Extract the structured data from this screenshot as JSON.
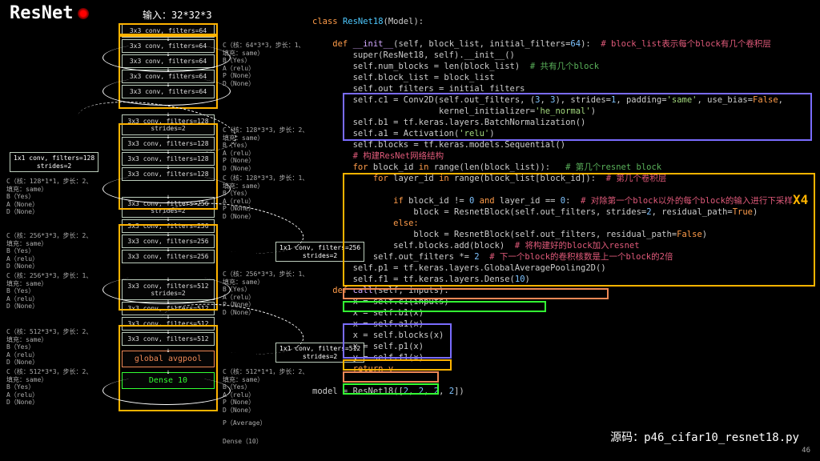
{
  "title": "ResNet",
  "input_label": "输入：32*32*3",
  "layers": [
    "3x3 conv, filters=64",
    "3x3 conv, filters=64",
    "3x3 conv, filters=64",
    "3x3 conv, filters=64",
    "3x3 conv, filters=64",
    "3x3 conv, filters=128\nstrides=2",
    "3x3 conv, filters=128",
    "3x3 conv, filters=128",
    "3x3 conv, filters=128",
    "3x3 conv, filters=256\nstrides=2",
    "3x3 conv, filters=256",
    "3x3 conv, filters=256",
    "3x3 conv, filters=256",
    "3x3 conv, filters=512\nstrides=2",
    "3x3 conv, filters=512",
    "3x3 conv, filters=512",
    "3x3 conv, filters=512"
  ],
  "final_pool": "global avgpool",
  "final_dense": "Dense 10",
  "side128": "1x1 conv, filters=128\nstrides=2",
  "side256": "1x1 conv, filters=256\nstrides=2",
  "side512": "1x1 conv, filters=512\nstrides=2",
  "ann": {
    "c64": "C（核：64*3*3，步长：1、\n填充：same）\nB（Yes）\nA（relu）\nP（None）\nD（None）",
    "c128a": "C（核：128*3*3，步长：2、\n填充：same）\nB（Yes）\nA（relu）\nP（None）\nD（None）",
    "c128b": "C（核：128*3*3，步长：1、\n填充：same）\nB（Yes）\nA（relu）\nP（None）\nD（None）",
    "c256": "C（核：256*3*3，步长：1、\n填充：same）\nB（Yes）\nA（relu）\nP（None）\nD（None）",
    "c512": "C（核：512*1*1，步长：2、\n填充：same）\nB（Yes）\nA（relu）\nP（None）\nD（None）",
    "s128": "C（核：128*1*1，步长：2、\n填充：same）\nB（Yes）\nA（None）\nD（None）",
    "s256a": "C（核：256*3*3，步长：2、\n填充：same）\nB（Yes）\nA（relu）\nD（None）",
    "s256b": "C（核：256*3*3，步长：1、\n填充：same）\nB（Yes）\nA（relu）\nD（None）",
    "s512": "C（核：512*3*3，步长：2、\n填充：same）\nB（Yes）\nA（relu）\nD（None）",
    "pavg": "P（Average）",
    "dense": "Dense（10）"
  },
  "x4": "X4",
  "source": "源码：p46_cifar10_resnet18.py",
  "page": "46",
  "code": {
    "l1a": "class ",
    "l1b": "ResNet18",
    "l1c": "(Model):",
    "l2a": "    def ",
    "l2b": "__init__",
    "l2c": "(self, block_list, initial_filters=",
    "l2d": "64",
    "l2e": "):  ",
    "l2f": "# block_list表示每个block有几个卷积层",
    "l3": "        super(ResNet18, self).__init__()",
    "l4a": "        self.num_blocks = len(block_list)  ",
    "l4b": "# 共有几个block",
    "l5": "        self.block_list = block_list",
    "l6": "        self.out_filters = initial_filters",
    "l7a": "        self.c1 = Conv2D(self.out_filters, (",
    "l7b": "3",
    "l7c": ", ",
    "l7d": "3",
    "l7e": "), strides=",
    "l7f": "1",
    "l7g": ", padding=",
    "l7h": "'same'",
    "l7i": ", use_bias=",
    "l7j": "False",
    "l7k": ",",
    "l8a": "                         kernel_initializer=",
    "l8b": "'he_normal'",
    "l8c": ")",
    "l9": "        self.b1 = tf.keras.layers.BatchNormalization()",
    "l10a": "        self.a1 = Activation(",
    "l10b": "'relu'",
    "l10c": ")",
    "l11": "        self.blocks = tf.keras.models.Sequential()",
    "l12": "        # 构建ResNet网络结构",
    "l13a": "        for ",
    "l13b": "block_id ",
    "l13c": "in ",
    "l13d": "range(len(block_list)):   ",
    "l13e": "# 第几个resnet block",
    "l14a": "            for ",
    "l14b": "layer_id ",
    "l14c": "in ",
    "l14d": "range(block_list[block_id]):  ",
    "l14e": "# 第几个卷积层",
    "l15a": "                if ",
    "l15b": "block_id != ",
    "l15c": "0 ",
    "l15d": "and ",
    "l15e": "layer_id == ",
    "l15f": "0",
    "l15g": ":  ",
    "l15h": "# 对除第一个block以外的每个block的输入进行下采样",
    "l16a": "                    block = ResnetBlock(self.out_filters, strides=",
    "l16b": "2",
    "l16c": ", residual_path=",
    "l16d": "True",
    "l16e": ")",
    "l17": "                else:",
    "l18a": "                    block = ResnetBlock(self.out_filters, residual_path=",
    "l18b": "False",
    "l18c": ")",
    "l19a": "                self.blocks.add(block)  ",
    "l19b": "# 将构建好的block加入resnet",
    "l20a": "            self.out_filters *= ",
    "l20b": "2  ",
    "l20c": "# 下一个block的卷积核数是上一个block的2倍",
    "l21": "        self.p1 = tf.keras.layers.GlobalAveragePooling2D()",
    "l22a": "        self.f1 = tf.keras.layers.Dense(",
    "l22b": "10",
    "l22c": ")",
    "l23a": "    def ",
    "l23b": "call",
    "l23c": "(self, inputs):",
    "l24": "        x = self.c1(inputs)",
    "l25": "        x = self.b1(x)",
    "l26": "        x = self.a1(x)",
    "l27": "        x = self.blocks(x)",
    "l28": "        x = self.p1(x)",
    "l29": "        y = self.f1(x)",
    "l30": "        return y",
    "l31a": "model = ResNet18([",
    "l31b": "2",
    "l31c": ", ",
    "l31d": "2",
    "l31e": ", ",
    "l31f": "2",
    "l31g": ", ",
    "l31h": "2",
    "l31i": "])"
  }
}
